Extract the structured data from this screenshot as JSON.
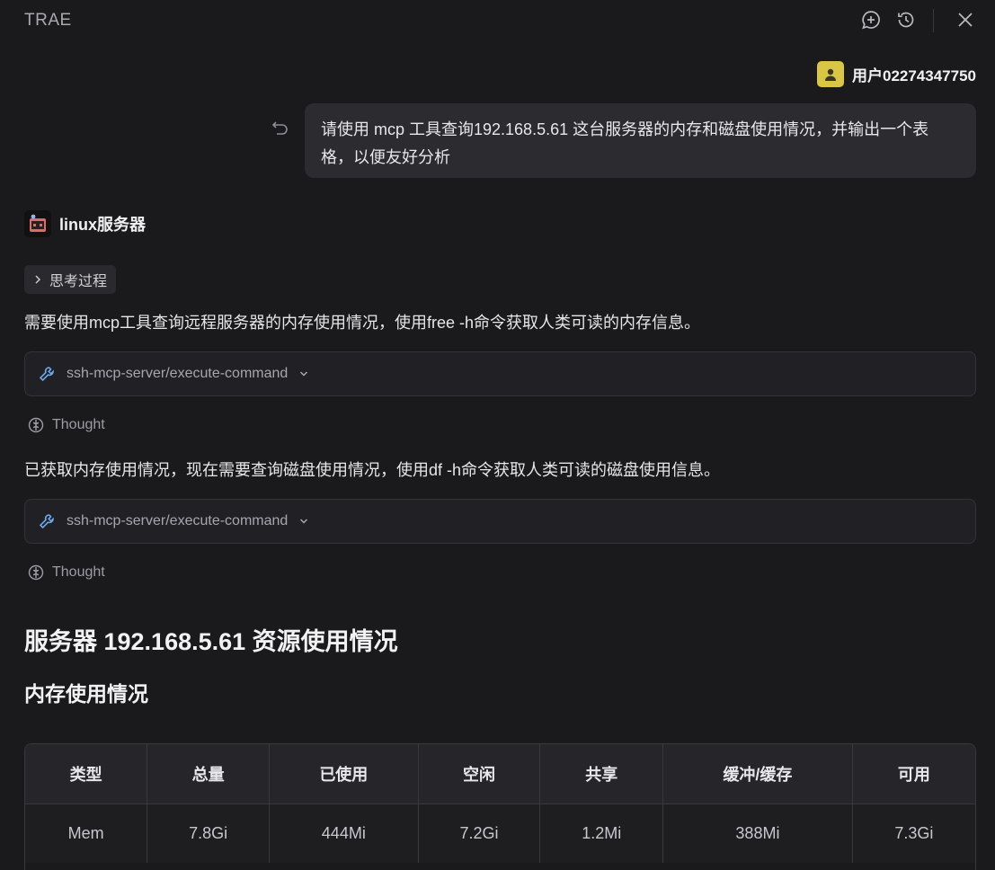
{
  "app": {
    "title": "TRAE"
  },
  "user": {
    "name": "用户02274347750",
    "message": "请使用 mcp 工具查询192.168.5.61 这台服务器的内存和磁盘使用情况，并输出一个表格，以便友好分析"
  },
  "agent": {
    "name": "linux服务器",
    "thinking_label": "思考过程",
    "step1_text": "需要使用mcp工具查询远程服务器的内存使用情况，使用free -h命令获取人类可读的内存信息。",
    "tool1_label": "ssh-mcp-server/execute-command",
    "thought1_label": "Thought",
    "step2_text": "已获取内存使用情况，现在需要查询磁盘使用情况，使用df -h命令获取人类可读的磁盘使用信息。",
    "tool2_label": "ssh-mcp-server/execute-command",
    "thought2_label": "Thought"
  },
  "report": {
    "title": "服务器 192.168.5.61 资源使用情况",
    "memory_heading": "内存使用情况",
    "memory_table": {
      "headers": [
        "类型",
        "总量",
        "已使用",
        "空闲",
        "共享",
        "缓冲/缓存",
        "可用"
      ],
      "rows": [
        [
          "Mem",
          "7.8Gi",
          "444Mi",
          "7.2Gi",
          "1.2Mi",
          "388Mi",
          "7.3Gi"
        ]
      ]
    }
  },
  "colors": {
    "avatar": "#d9c646",
    "tool_icon": "#6ea8e8",
    "background": "#1a1a1c"
  }
}
